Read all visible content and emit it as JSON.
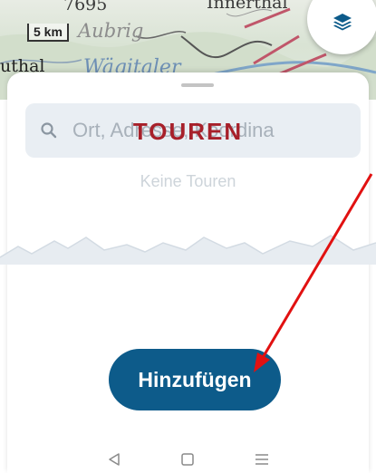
{
  "map": {
    "scale_label": "5 km",
    "labels": {
      "peak": "7695",
      "aubrig": "Aubrig",
      "euthal": "uthal",
      "waegital": "Wägitaler",
      "innerthal": "Innerthal"
    },
    "layers_icon": "layers-icon"
  },
  "search": {
    "placeholder": "Ort, Adresse, Koordina",
    "icon": "search-icon"
  },
  "tours": {
    "title": "TOUREN",
    "empty_text": "Keine Touren"
  },
  "add_button": {
    "label": "Hinzufügen"
  },
  "nav": {
    "back_icon": "back-icon",
    "home_icon": "home-icon",
    "menu_icon": "menu-icon"
  },
  "colors": {
    "title": "#a7202a",
    "button": "#0d5b8a",
    "search_bg": "#e9eef3",
    "arrow": "#e11111"
  }
}
